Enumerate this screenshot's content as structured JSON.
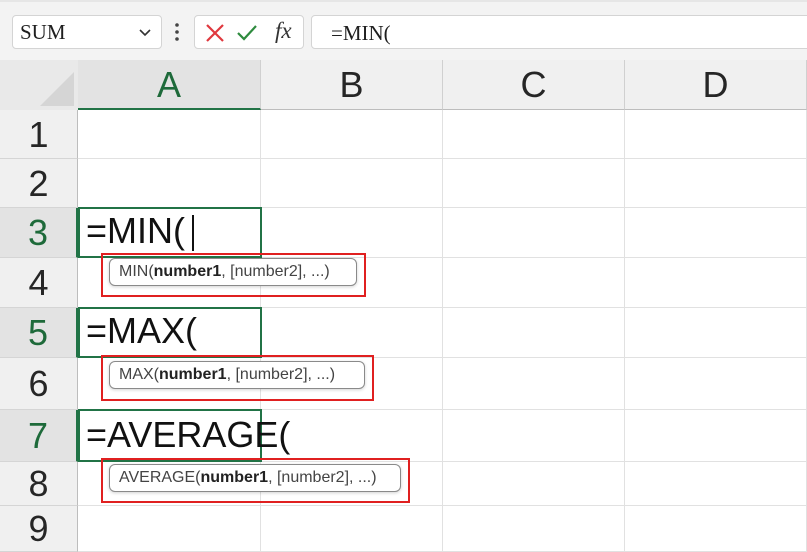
{
  "name_box": {
    "value": "SUM"
  },
  "formula_bar": {
    "value": "=MIN(",
    "fx_label": "fx"
  },
  "columns": [
    "A",
    "B",
    "C",
    "D"
  ],
  "rows": [
    "1",
    "2",
    "3",
    "4",
    "5",
    "6",
    "7",
    "8",
    "9"
  ],
  "cells": {
    "a3": "=MIN(",
    "a5": "=MAX(",
    "a7": "=AVERAGE("
  },
  "tooltips": [
    {
      "fn": "MIN(",
      "bold_arg": "number1",
      "rest": ", [number2], ...)"
    },
    {
      "fn": "MAX(",
      "bold_arg": "number1",
      "rest": ", [number2], ...)"
    },
    {
      "fn": "AVERAGE(",
      "bold_arg": "number1",
      "rest": ", [number2], ...)"
    }
  ],
  "colors": {
    "accent_green": "#217346",
    "highlight_red": "#e02020"
  }
}
